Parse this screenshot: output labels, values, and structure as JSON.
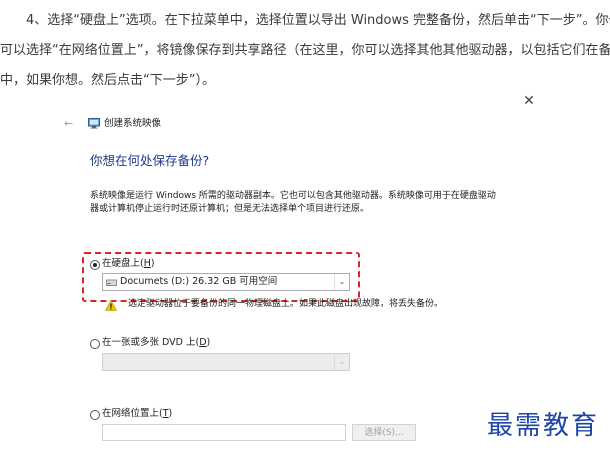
{
  "article": {
    "line1": "4、选择“硬盘上”选项。在下拉菜单中，选择位置以导出 Windows 完整备份，然后单击“下一步”。你也",
    "line2": "可以选择“在网络位置上”，将镜像保存到共享路径（在这里，你可以选择其他其他驱动器，以包括它们在备份",
    "line3": "中，如果你想。然后点击“下一步”）。"
  },
  "dialog": {
    "close_glyph": "✕",
    "back_glyph": "←",
    "window_title": "创建系统映像",
    "heading": "你想在何处保存备份?",
    "description": {
      "line1": "系统映像是运行 Windows 所需的驱动器副本。它也可以包含其他驱动器。系统映像可用于在硬盘驱动",
      "line2": "器或计算机停止运行时还原计算机；但是无法选择单个项目进行还原。"
    },
    "options": {
      "hard_disk": {
        "label": "在硬盘上(",
        "accel": "H",
        "label_end": ")",
        "checked": true,
        "selected_drive": "Documets (D:)  26.32 GB 可用空间",
        "warning": "选定驱动器位于要备份的同一物理磁盘上。如果此磁盘出现故障，将丢失备份。"
      },
      "dvd": {
        "label": "在一张或多张 DVD 上(",
        "accel": "D",
        "label_end": ")",
        "checked": false
      },
      "network": {
        "label": "在网络位置上(",
        "accel": "T",
        "label_end": ")",
        "checked": false,
        "select_button": "选择(S)..."
      }
    },
    "dropdown_arrow": "⌄"
  },
  "watermark": "最需教育",
  "colors": {
    "heading": "#1e3a8a",
    "highlight": "#d6262b",
    "watermark": "#1c45a6",
    "warning": "#f2c200"
  },
  "icons": {
    "window": "system-image-icon",
    "drive": "hard-drive-icon",
    "warning": "warning-icon"
  }
}
